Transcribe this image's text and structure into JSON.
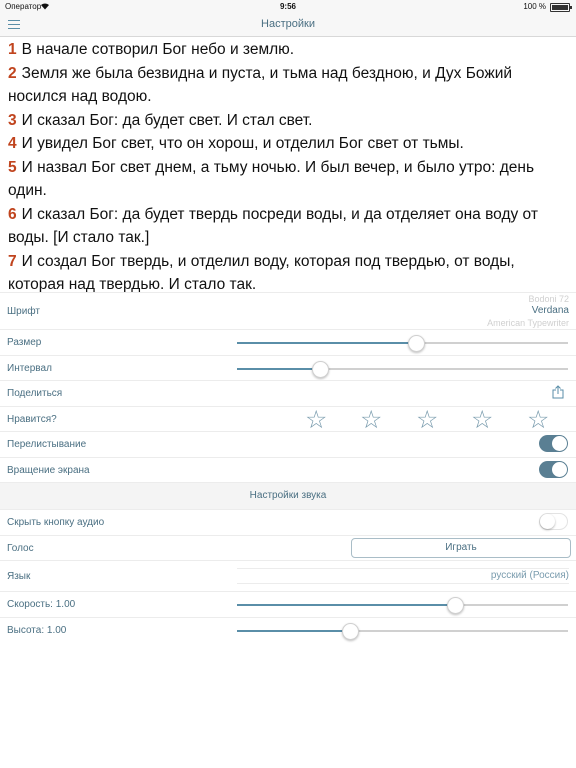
{
  "status_bar": {
    "carrier": "Оператор",
    "time": "9:56",
    "battery": "100 %"
  },
  "nav": {
    "title": "Настройки"
  },
  "verses": [
    {
      "num": "1",
      "text": "В начале сотворил Бог небо и землю."
    },
    {
      "num": "2",
      "text": "Земля же была безвидна и пуста, и тьма над бездною, и Дух Божий носился над водою."
    },
    {
      "num": "3",
      "text": "И сказал Бог: да будет свет. И стал свет."
    },
    {
      "num": "4",
      "text": "И увидел Бог свет, что он хорош, и отделил Бог свет от тьмы."
    },
    {
      "num": "5",
      "text": "И назвал Бог свет днем, а тьму ночью. И был вечер, и было утро: день один."
    },
    {
      "num": "6",
      "text": "И сказал Бог: да будет твердь посреди воды, и да отделяет она воду от воды. [И стало так.]"
    },
    {
      "num": "7",
      "text": "И создал Бог твердь, и отделил воду, которая под твердью, от воды, которая над твердью. И стало так."
    }
  ],
  "settings": {
    "font_label": "Шрифт",
    "font_options": [
      "Bodoni 72",
      "Verdana",
      "American Typewriter"
    ],
    "font_selected": "Verdana",
    "size_label": "Размер",
    "size_value": 0.54,
    "spacing_label": "Интервал",
    "spacing_value": 0.25,
    "share_label": "Поделиться",
    "like_label": "Нравится?",
    "stars_total": 5,
    "stars_filled": 0,
    "paging_label": "Перелистывание",
    "paging_on": true,
    "rotation_label": "Вращение экрана",
    "rotation_on": true
  },
  "sound": {
    "header": "Настройки звука",
    "hide_audio_label": "Скрыть кнопку аудио",
    "hide_audio_on": false,
    "voice_label": "Голос",
    "play_label": "Играть",
    "language_label": "Язык",
    "language_value": "русский (Россия)",
    "speed_label": "Скорость: 1.00",
    "speed_value": 0.66,
    "pitch_label": "Высота: 1.00",
    "pitch_value": 0.34
  },
  "icons": {
    "menu": "menu-icon",
    "share": "share-icon",
    "star": "star-outline-icon",
    "wifi": "wifi-icon",
    "battery": "battery-icon"
  },
  "colors": {
    "accent": "#5a8ea8",
    "verse_number": "#c0441e",
    "label": "#4a6f82",
    "toggle_on": "#5a7f93"
  }
}
